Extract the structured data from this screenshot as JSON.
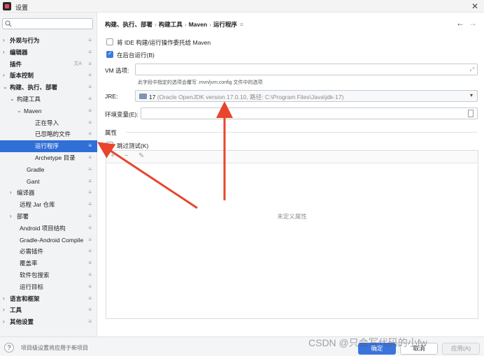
{
  "window": {
    "title": "设置"
  },
  "sidebar": {
    "search": {
      "placeholder": ""
    },
    "items": [
      {
        "label": "外观与行为",
        "bold": true,
        "chevron": "right"
      },
      {
        "label": "编辑器",
        "bold": true,
        "chevron": "right"
      },
      {
        "label": "插件",
        "bold": true,
        "chevron": "",
        "lang_icon": true
      },
      {
        "label": "版本控制",
        "bold": true,
        "chevron": "right"
      },
      {
        "label": "构建、执行、部署",
        "bold": true,
        "chevron": "down"
      },
      {
        "label": "构建工具",
        "bold": false,
        "chevron": "down"
      },
      {
        "label": "Maven",
        "bold": false,
        "chevron": "down"
      },
      {
        "label": "正在导入",
        "bold": false,
        "chevron": ""
      },
      {
        "label": "已忽略的文件",
        "bold": false,
        "chevron": ""
      },
      {
        "label": "运行程序",
        "bold": false,
        "chevron": "",
        "selected": true
      },
      {
        "label": "Archetype 目录",
        "bold": false,
        "chevron": ""
      },
      {
        "label": "Gradle",
        "bold": false,
        "chevron": ""
      },
      {
        "label": "Gant",
        "bold": false,
        "chevron": ""
      },
      {
        "label": "编译器",
        "bold": false,
        "chevron": "right"
      },
      {
        "label": "远程 Jar 仓库",
        "bold": false,
        "chevron": ""
      },
      {
        "label": "部署",
        "bold": false,
        "chevron": "right"
      },
      {
        "label": "Android 项目结构",
        "bold": false,
        "chevron": ""
      },
      {
        "label": "Gradle-Android Compile",
        "bold": false,
        "chevron": ""
      },
      {
        "label": "必需插件",
        "bold": false,
        "chevron": ""
      },
      {
        "label": "覆盖率",
        "bold": false,
        "chevron": ""
      },
      {
        "label": "软件包搜索",
        "bold": false,
        "chevron": ""
      },
      {
        "label": "运行目标",
        "bold": false,
        "chevron": ""
      },
      {
        "label": "语言和框架",
        "bold": true,
        "chevron": "right"
      },
      {
        "label": "工具",
        "bold": true,
        "chevron": "right"
      },
      {
        "label": "其他设置",
        "bold": true,
        "chevron": "right"
      }
    ]
  },
  "breadcrumb": {
    "part1": "构建、执行、部署",
    "part2": "构建工具",
    "part3": "Maven",
    "part4": "运行程序"
  },
  "delegate_checkbox": {
    "label": "将 IDE 构建/运行操作委托给 Maven",
    "checked": false
  },
  "background_checkbox": {
    "label": "在后台运行(B)",
    "checked": true
  },
  "vm_options": {
    "label": "VM 选项:",
    "value": "",
    "hint": "此字段中指定的选项会覆写 .mvn/jvm.config 文件中的选项"
  },
  "jre": {
    "label": "JRE:",
    "version": "17",
    "detail": "(Oracle OpenJDK version 17.0.10, 路径: C:\\Program Files\\Java\\jdk-17)"
  },
  "env_vars": {
    "label": "环境变量(E):",
    "value": ""
  },
  "properties": {
    "label": "属性",
    "empty_text": "未定义属性"
  },
  "skip_tests": {
    "label": "跳过测试(K)",
    "checked": false
  },
  "footer": {
    "hint": "项目级设置将应用于新项目",
    "ok": "确定",
    "cancel": "取消",
    "apply": "应用(A)"
  },
  "watermark": "CSDN @只会写代码的小fw",
  "colors": {
    "accent": "#3a74dd",
    "selected": "#2f6fd6",
    "arrow": "#e8452c"
  },
  "icons": [
    "search-icon",
    "close-icon",
    "back-arrow-icon",
    "forward-arrow-icon",
    "options-icon",
    "expand-icon",
    "folder-icon",
    "dropdown-icon",
    "document-icon",
    "add-icon",
    "remove-icon",
    "edit-icon",
    "help-icon"
  ]
}
